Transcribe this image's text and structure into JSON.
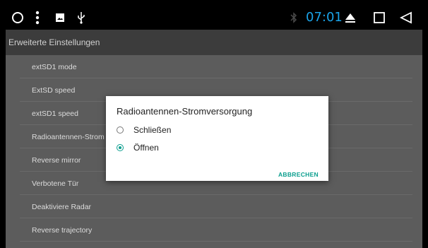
{
  "statusbar": {
    "time": "07:01",
    "icons": [
      "circle-icon",
      "more-vert-icon",
      "image-icon",
      "usb-icon",
      "bluetooth-icon",
      "eject-icon",
      "square-recents-icon",
      "back-triangle-icon"
    ]
  },
  "actionbar": {
    "title": "Erweiterte Einstellungen"
  },
  "list": {
    "items": [
      {
        "label": "extSD1 mode"
      },
      {
        "label": "ExtSD speed"
      },
      {
        "label": "extSD1 speed"
      },
      {
        "label": "Radioantennen-Strom"
      },
      {
        "label": "Reverse mirror"
      },
      {
        "label": "Verbotene Tür"
      },
      {
        "label": "Deaktiviere Radar"
      },
      {
        "label": "Reverse trajectory"
      }
    ]
  },
  "dialog": {
    "title": "Radioantennen-Stromversorgung",
    "options": [
      {
        "label": "Schließen",
        "selected": false
      },
      {
        "label": "Öffnen",
        "selected": true
      }
    ],
    "cancel_label": "ABBRECHEN"
  },
  "colors": {
    "accent": "#0a9e8e",
    "time": "#1aa3e8"
  }
}
